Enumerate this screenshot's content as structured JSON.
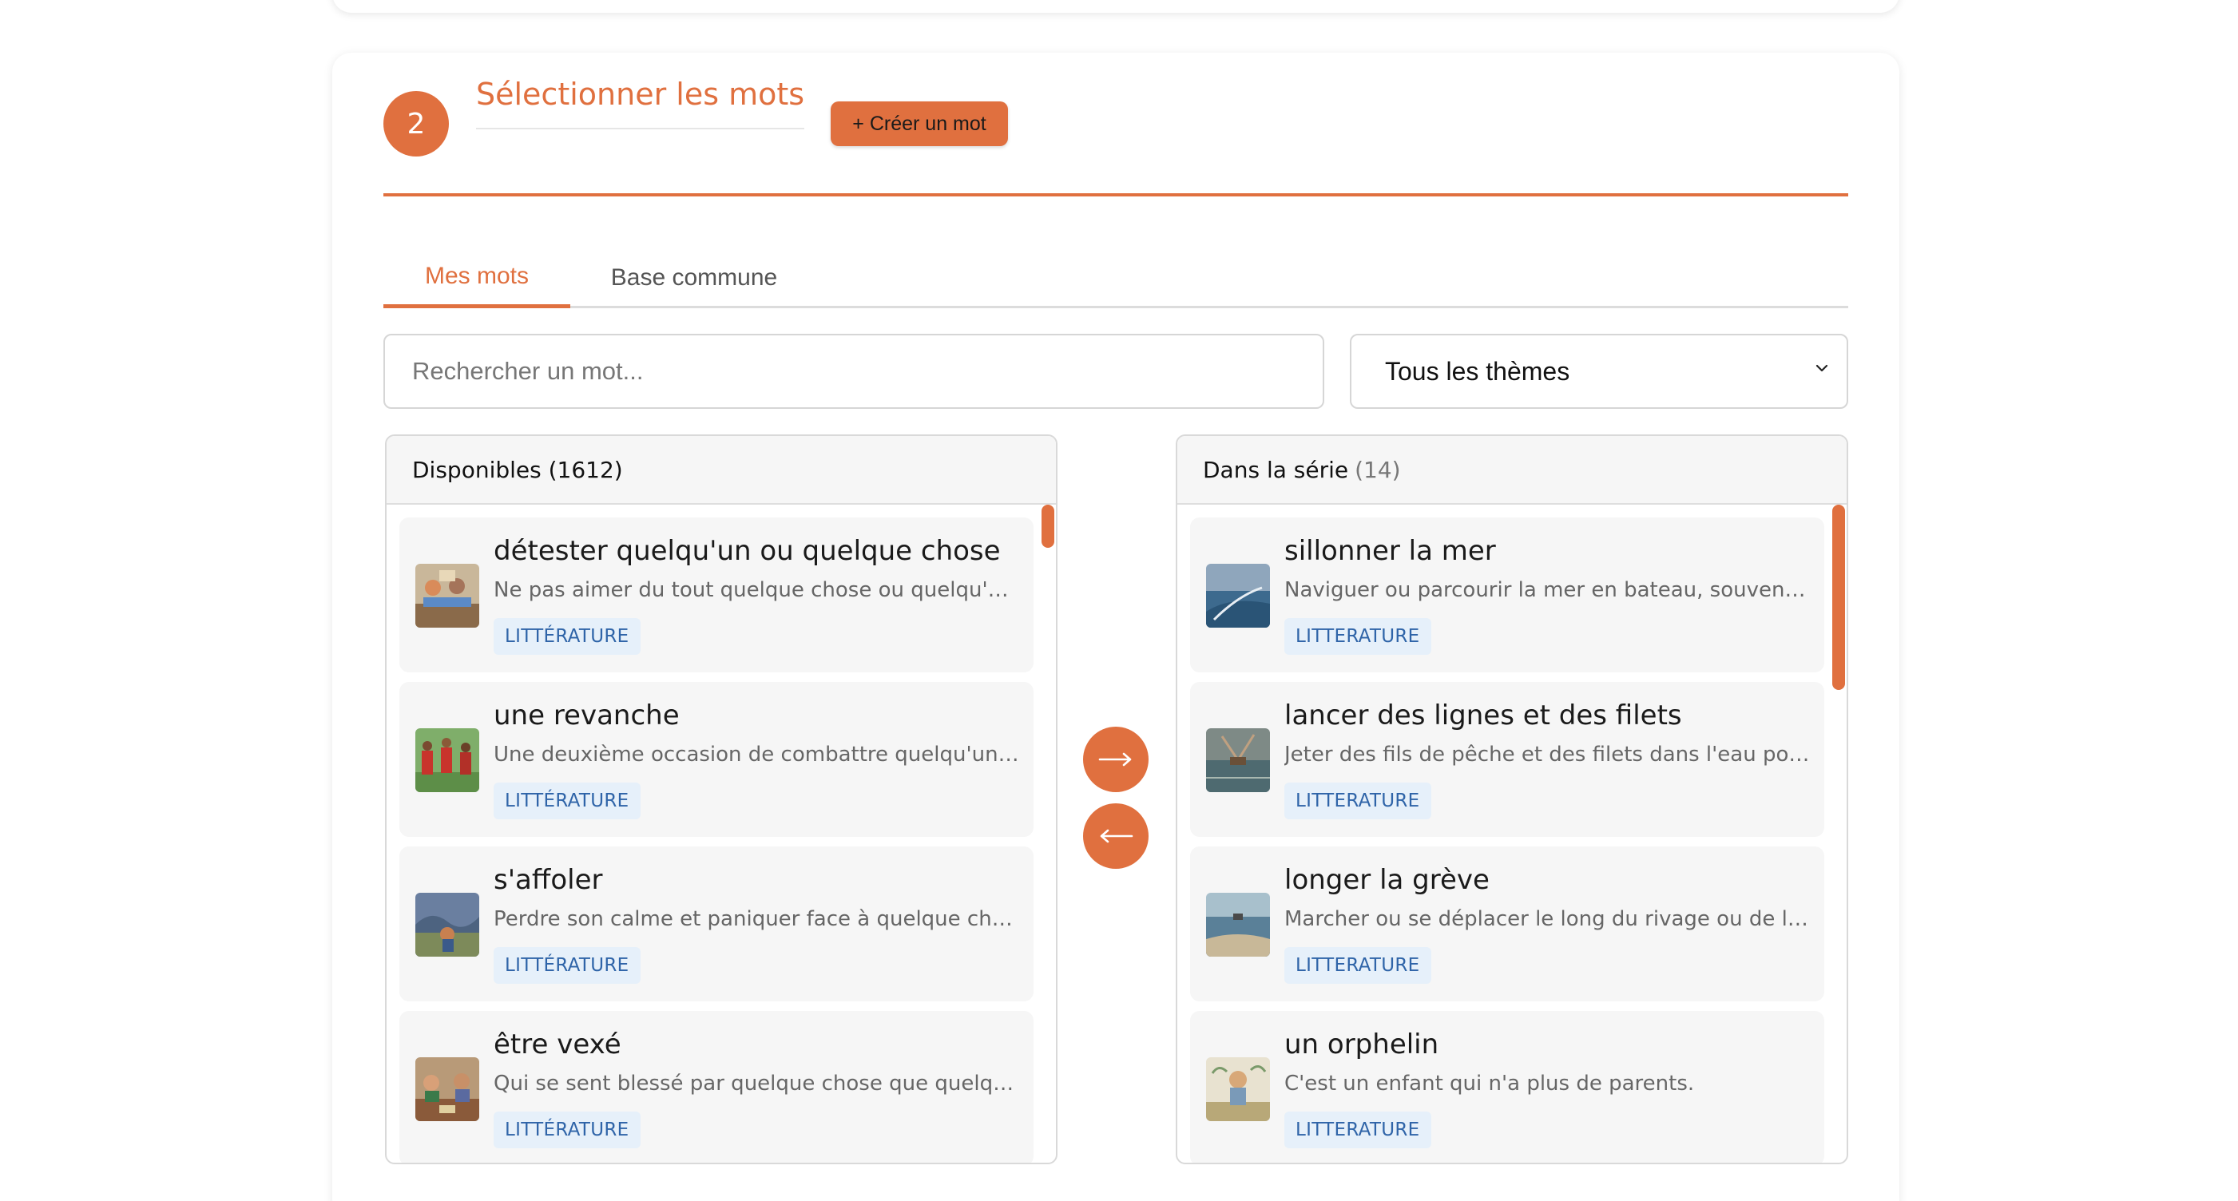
{
  "colors": {
    "accent": "#e0703f",
    "tag_bg": "#e6f0fa",
    "tag_text": "#2f64a8"
  },
  "step": {
    "number": "2",
    "title": "Sélectionner les mots",
    "create_button": "+ Créer un mot"
  },
  "tabs": [
    {
      "label": "Mes mots",
      "active": true
    },
    {
      "label": "Base commune",
      "active": false
    }
  ],
  "search": {
    "placeholder": "Rechercher un mot...",
    "value": ""
  },
  "theme_select": {
    "selected": "Tous les thèmes",
    "icon": "chevron-down-icon"
  },
  "available": {
    "title": "Disponibles (1612)",
    "items": [
      {
        "word": "détester quelqu'un ou quelque chose",
        "desc": "Ne pas aimer du tout quelque chose ou quelqu'un. ...",
        "tag": "LITTÉRATURE"
      },
      {
        "word": "une revanche",
        "desc": "Une deuxième occasion de combattre quelqu'un ou...",
        "tag": "LITTÉRATURE"
      },
      {
        "word": "s'affoler",
        "desc": "Perdre son calme et paniquer face à quelque chose...",
        "tag": "LITTÉRATURE"
      },
      {
        "word": "être vexé",
        "desc": "Qui se sent blessé par quelque chose que quelqu'u...",
        "tag": "LITTÉRATURE"
      }
    ]
  },
  "series": {
    "title": "Dans la série",
    "count": "(14)",
    "items": [
      {
        "word": "sillonner la mer",
        "desc": "Naviguer ou parcourir la mer en bateau, souvent po...",
        "tag": "LITTERATURE"
      },
      {
        "word": "lancer des lignes et des filets",
        "desc": "Jeter des fils de pêche et des filets dans l'eau pour ...",
        "tag": "LITTERATURE"
      },
      {
        "word": "longer la grève",
        "desc": "Marcher ou se déplacer le long du rivage ou de la p...",
        "tag": "LITTERATURE"
      },
      {
        "word": "un orphelin",
        "desc": "C'est un enfant qui n'a plus de parents.",
        "tag": "LITTERATURE"
      }
    ]
  },
  "transfer": {
    "add_icon": "arrow-right-icon",
    "remove_icon": "arrow-left-icon"
  }
}
